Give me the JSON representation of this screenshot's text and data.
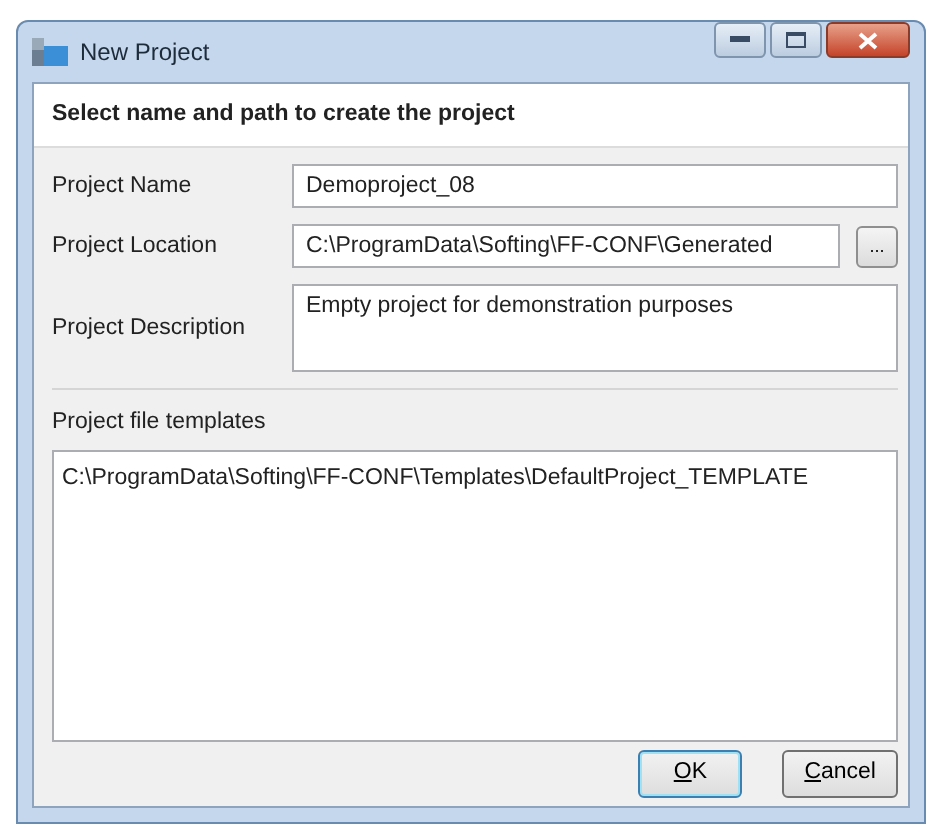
{
  "window": {
    "title": "New Project"
  },
  "heading": "Select name and path to create the project",
  "fields": [
    {
      "label": "Project Name",
      "value": "Demoproject_08",
      "kind": "text"
    },
    {
      "label": "Project Location",
      "value": "C:\\ProgramData\\Softing\\FF-CONF\\Generated",
      "kind": "browse",
      "button": "..."
    },
    {
      "label": "Project Description",
      "value": "Empty project for demonstration purposes",
      "kind": "multiline"
    }
  ],
  "templates": {
    "label": "Project file templates",
    "items": [
      "C:\\ProgramData\\Softing\\FF-CONF\\Templates\\DefaultProject_TEMPLATE"
    ]
  },
  "buttons": [
    "OK",
    "Cancel"
  ]
}
